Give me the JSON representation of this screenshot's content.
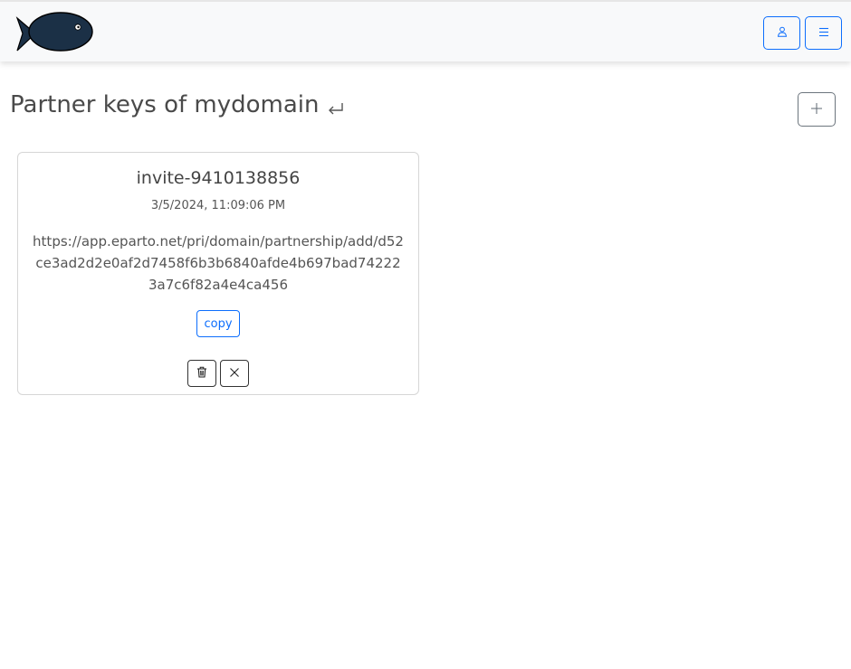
{
  "header": {
    "logo_icon": "fish-logo-icon",
    "user_icon": "user-icon",
    "menu_icon": "hamburger-menu-icon"
  },
  "page": {
    "title": "Partner keys of mydomain",
    "back_icon": "return-arrow-icon",
    "add_icon": "plus-icon"
  },
  "invites": [
    {
      "name": "invite-9410138856",
      "date": "3/5/2024, 11:09:06 PM",
      "url": "https://app.eparto.net/pri/domain/partnership/add/d52ce3ad2d2e0af2d7458f6b3b6840afde4b697bad742223a7c6f82a4e4ca456",
      "copy_label": "copy",
      "delete_icon": "trash-icon",
      "close_icon": "close-icon"
    }
  ],
  "colors": {
    "accent": "#0d6efd",
    "navbar_bg": "#f8f9fa",
    "logo_fish": "#1b3046"
  }
}
